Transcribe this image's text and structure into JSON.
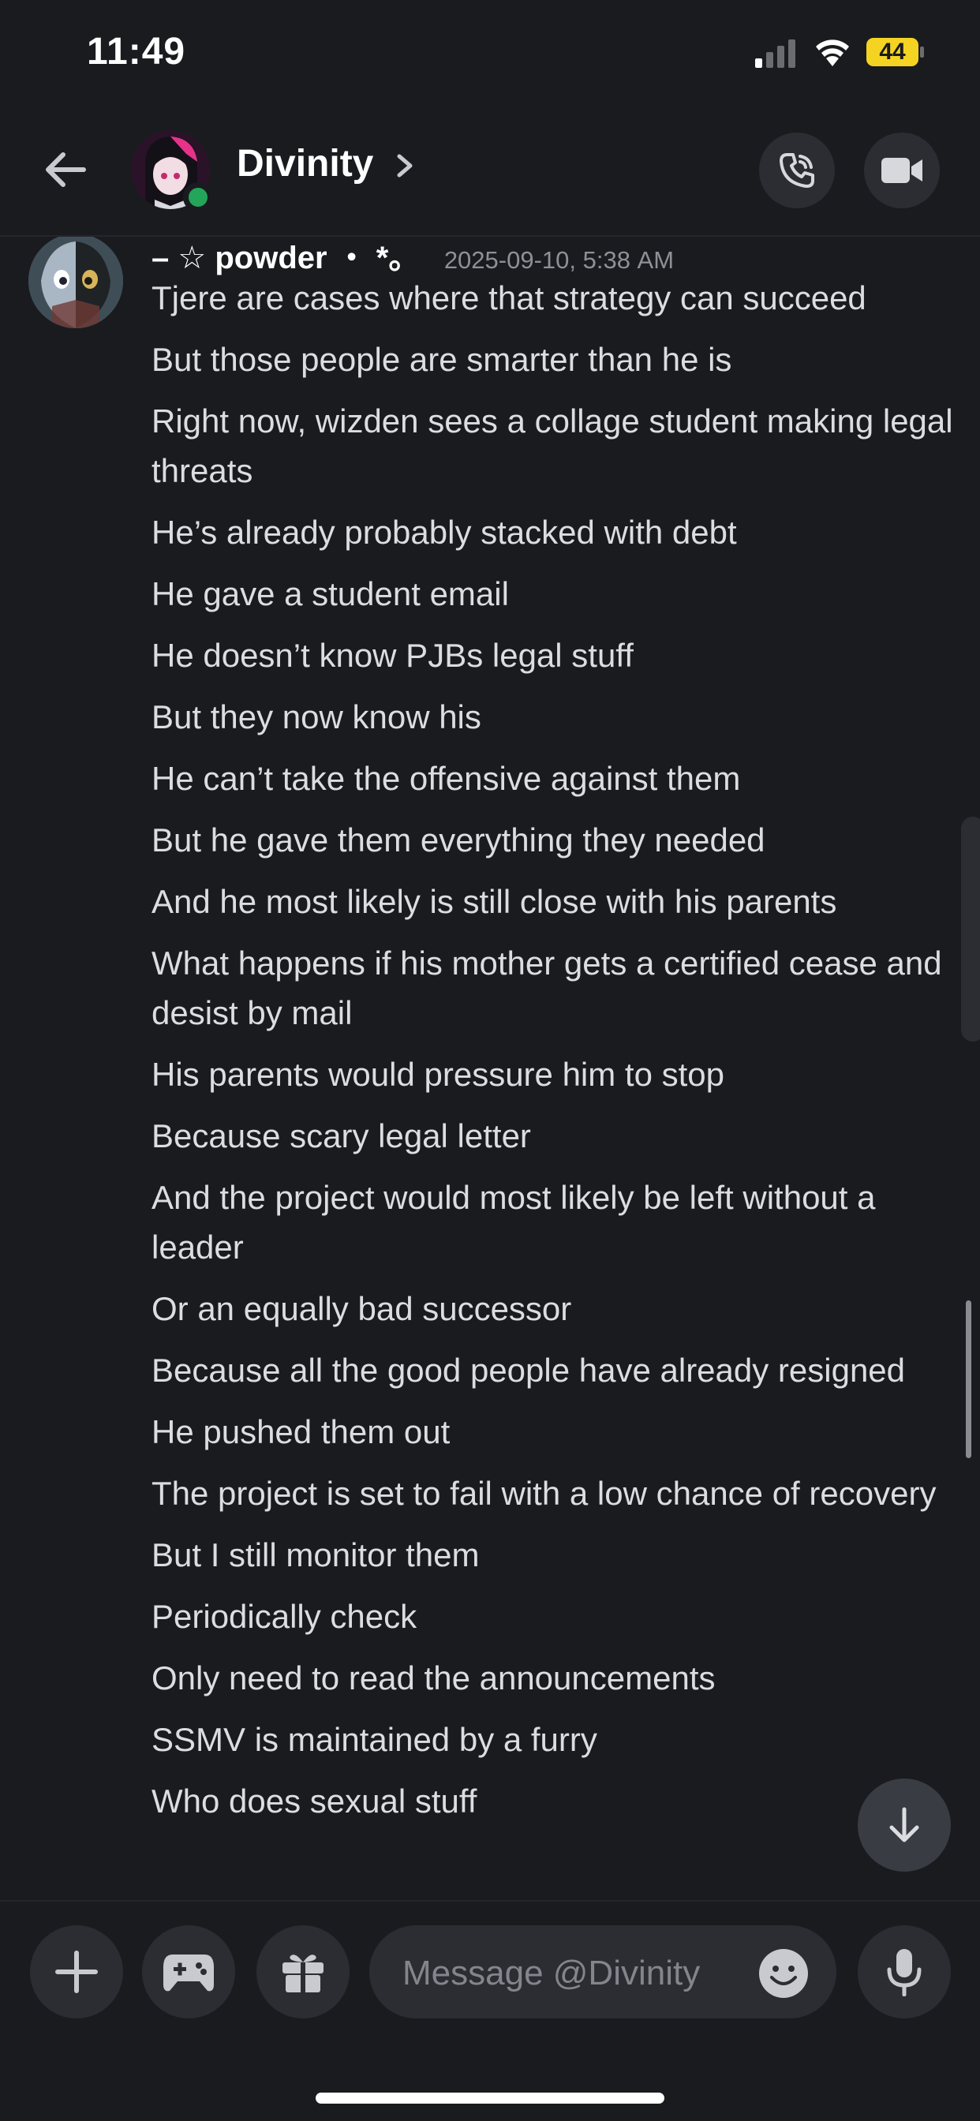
{
  "status_bar": {
    "time": "11:49",
    "battery_level": "44",
    "battery_color": "#f5d322"
  },
  "header": {
    "title": "Divinity",
    "back_icon": "arrow-left-icon",
    "call_icon": "phone-call-icon",
    "video_icon": "video-camera-icon",
    "presence": "online",
    "presence_color": "#23a55a"
  },
  "message": {
    "author": "– ☆ powder ・ *。",
    "timestamp": "2025-09-10, 5:38 AM",
    "lines": [
      "Tjere are cases where that strategy can succeed",
      "But those people are smarter than he is",
      "Right now, wizden sees a collage student making legal threats",
      "He’s already probably stacked with debt",
      "He gave a student email",
      "He doesn’t know PJBs legal stuff",
      "But they now know his",
      "He can’t take the offensive against them",
      "But he gave them everything they needed",
      "And he most likely is still close with his parents",
      "What happens if his mother gets a certified cease and desist by mail",
      "His parents would pressure him to stop",
      "Because scary legal letter",
      "And the project would most likely be left without a leader",
      "Or an equally bad successor",
      "Because all the good people have already resigned",
      "He pushed them out",
      "The project is set to fail with a low chance of recovery",
      "But I still monitor them",
      "Periodically check",
      "Only need to read the announcements",
      "SSMV is maintained by a furry",
      "Who does sexual stuff"
    ]
  },
  "jump_to_present_icon": "arrow-down-icon",
  "composer": {
    "placeholder": "Message @Divinity",
    "plus_icon": "plus-icon",
    "games_icon": "gamepad-icon",
    "gift_icon": "gift-icon",
    "emoji_icon": "emoji-icon",
    "mic_icon": "microphone-icon"
  }
}
